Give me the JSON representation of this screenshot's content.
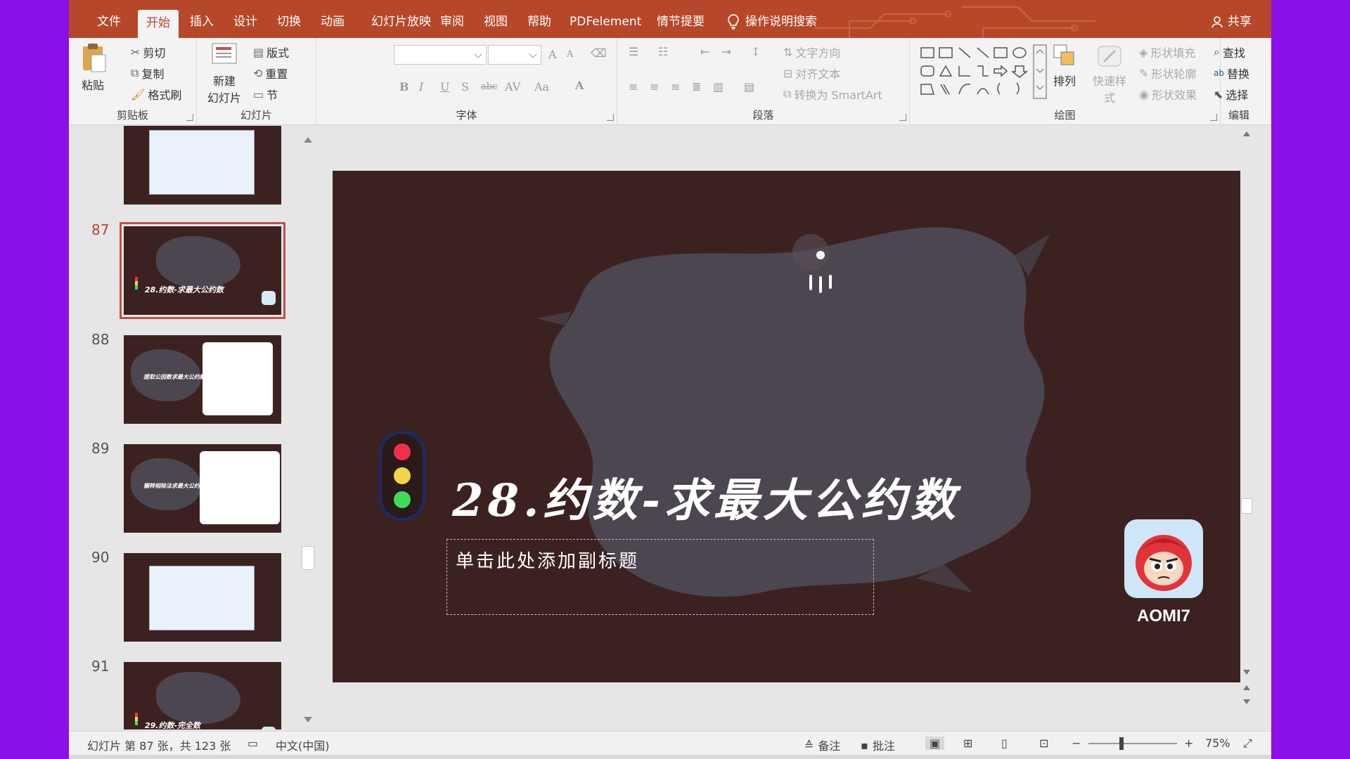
{
  "ribbon_tabs": [
    "文件",
    "开始",
    "插入",
    "设计",
    "切换",
    "动画",
    "幻灯片放映",
    "审阅",
    "视图",
    "帮助",
    "PDFelement",
    "情节提要"
  ],
  "active_tab": "开始",
  "tell_me": "操作说明搜索",
  "share": "共享",
  "clipboard": {
    "paste": "粘贴",
    "cut": "剪切",
    "copy": "复制",
    "format_painter": "格式刷",
    "label": "剪贴板"
  },
  "slides_group": {
    "new_slide_1": "新建",
    "new_slide_2": "幻灯片",
    "layout": "版式",
    "reset": "重置",
    "section": "节",
    "label": "幻灯片"
  },
  "font_group": {
    "label": "字体",
    "bold": "B",
    "italic": "I",
    "underline": "U",
    "strike": "S",
    "strikethrough": "abc",
    "spacing": "AV",
    "case": "Aa",
    "grow": "A",
    "shrink": "A",
    "color": "A"
  },
  "paragraph_group": {
    "label": "段落",
    "text_direction": "文字方向",
    "align_text": "对齐文本",
    "smartart": "转换为 SmartArt"
  },
  "drawing_group": {
    "label": "绘图",
    "arrange": "排列",
    "quick_styles": "快速样式",
    "shape_fill": "形状填充",
    "shape_outline": "形状轮廓",
    "shape_effects": "形状效果"
  },
  "editing_group": {
    "label": "编辑",
    "find": "查找",
    "replace": "替换",
    "select": "选择"
  },
  "thumbnails": [
    {
      "num": "",
      "kind": "screen",
      "title": ""
    },
    {
      "num": "87",
      "kind": "title",
      "title": "28.约数-求最大公约数",
      "selected": true
    },
    {
      "num": "88",
      "kind": "card",
      "title": "提取公因数求最大公约数"
    },
    {
      "num": "89",
      "kind": "card",
      "title": "辗转相除法求最大公约数"
    },
    {
      "num": "90",
      "kind": "screen",
      "title": ""
    },
    {
      "num": "91",
      "kind": "title",
      "title": "29.约数-完全数"
    }
  ],
  "slide": {
    "title": "28.约数-求最大公约数",
    "subtitle_placeholder": "单击此处添加副标题",
    "logo_text": "AOMI7"
  },
  "colors": {
    "brand": "#b7472a",
    "slide_bg": "#3b2221",
    "brush": "#4c4650",
    "red": "#f0304a",
    "yellow": "#f1d44a",
    "green": "#3fdc5a"
  },
  "status": {
    "slide_info": "幻灯片 第 87 张，共 123 张",
    "language": "中文(中国)",
    "notes": "备注",
    "comments": "批注",
    "zoom_minus": "−",
    "zoom_plus": "+",
    "zoom": "75%"
  }
}
